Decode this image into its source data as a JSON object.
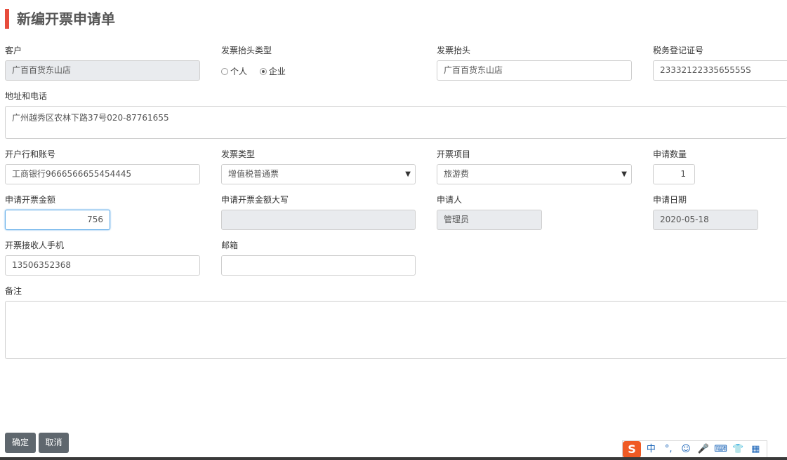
{
  "page": {
    "title": "新编开票申请单",
    "accent_color": "#e74c3c"
  },
  "form": {
    "customer": {
      "label": "客户",
      "value": "广百百货东山店"
    },
    "header_type": {
      "label": "发票抬头类型",
      "options": [
        "个人",
        "企业"
      ],
      "selected": "企业"
    },
    "invoice_header": {
      "label": "发票抬头",
      "value": "广百百货东山店"
    },
    "tax_id": {
      "label": "税务登记证号",
      "value": "2333212233565555S"
    },
    "address_phone": {
      "label": "地址和电话",
      "value": "广州越秀区农林下路37号020-87761655"
    },
    "bank_account": {
      "label": "开户行和账号",
      "value": "工商银行9666566655454445"
    },
    "invoice_type": {
      "label": "发票类型",
      "value": "增值税普通票"
    },
    "invoice_item": {
      "label": "开票项目",
      "value": "旅游费"
    },
    "quantity": {
      "label": "申请数量",
      "value": "1"
    },
    "amount": {
      "label": "申请开票金额",
      "value": "756"
    },
    "amount_upper": {
      "label": "申请开票金额大写",
      "value": ""
    },
    "applicant": {
      "label": "申请人",
      "value": "管理员"
    },
    "apply_date": {
      "label": "申请日期",
      "value": "2020-05-18"
    },
    "receiver_phone": {
      "label": "开票接收人手机",
      "value": "13506352368"
    },
    "email": {
      "label": "邮箱",
      "value": ""
    },
    "remark": {
      "label": "备注",
      "value": ""
    }
  },
  "actions": {
    "confirm": "确定",
    "cancel": "取消",
    "button_color": "#5f676e"
  },
  "ime": {
    "logo": "S",
    "items": [
      "中",
      "°,",
      "☺",
      "🎤",
      "⌨",
      "👕",
      "▦"
    ]
  }
}
